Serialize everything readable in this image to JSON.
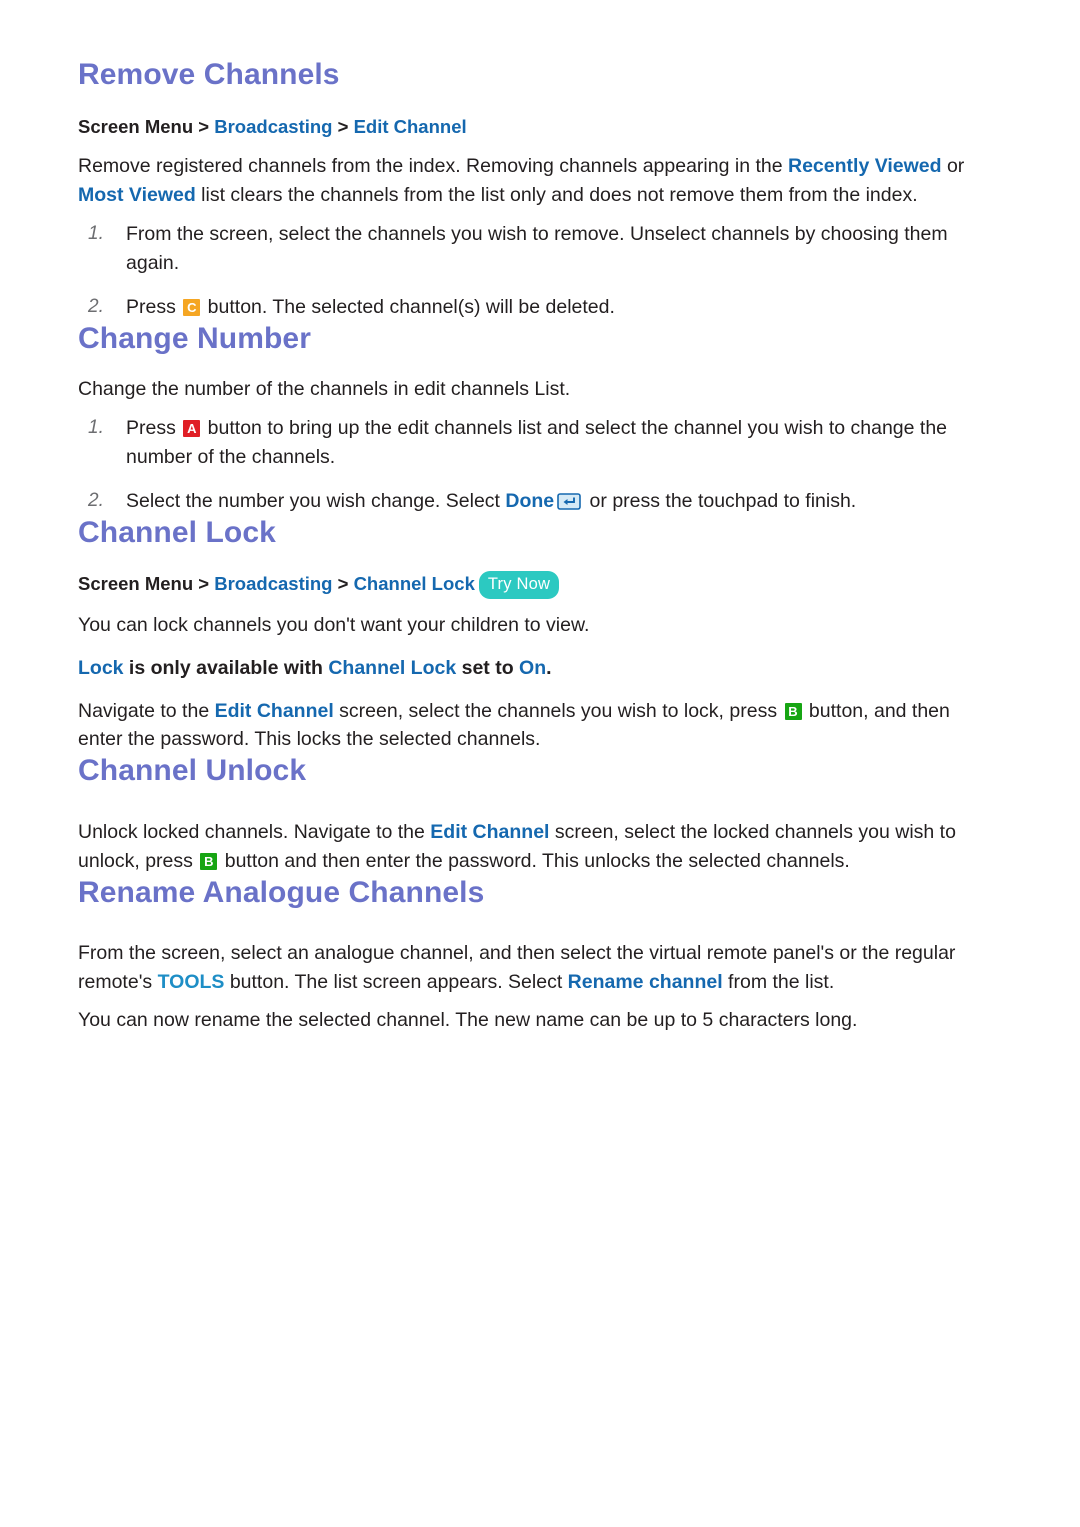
{
  "colors": {
    "heading": "#6a72c8",
    "link": "#1568af",
    "link_light": "#1e8ec6",
    "key_a": "#e01f26",
    "key_b": "#17a513",
    "key_c": "#f5a623",
    "try_now": "#2cc9c1",
    "body": "#231f20",
    "step_number": "#6d6e71"
  },
  "sections": {
    "remove_channels": {
      "title": "Remove Channels",
      "breadcrumb": {
        "root": "Screen Menu",
        "sep": ">",
        "level1": "Broadcasting",
        "level2": "Edit Channel"
      },
      "intro": {
        "part1": "Remove registered channels from the index. Removing channels appearing in the ",
        "link1": "Recently Viewed",
        "part2": " or ",
        "link2": "Most Viewed",
        "part3": " list clears the channels from the list only and does not remove them from the index."
      },
      "steps": [
        {
          "number": "1.",
          "text": "From the screen, select the channels you wish to remove. Unselect channels by choosing them again."
        },
        {
          "number": "2.",
          "prefix": "Press ",
          "key": "C",
          "suffix": " button. The selected channel(s) will be deleted."
        }
      ]
    },
    "change_number": {
      "title": "Change Number",
      "intro": "Change the number of the channels in edit channels List.",
      "steps": [
        {
          "number": "1.",
          "prefix": "Press ",
          "key": "A",
          "suffix": " button to bring up the edit channels list and select the channel you wish to change the number of the channels."
        },
        {
          "number": "2.",
          "prefix": "Select the number you wish change. Select ",
          "link": "Done",
          "icon": "enter-key-icon",
          "suffix": " or press the touchpad to finish."
        }
      ]
    },
    "channel_lock": {
      "title": "Channel Lock",
      "breadcrumb": {
        "root": "Screen Menu",
        "sep": ">",
        "level1": "Broadcasting",
        "level2": "Channel Lock",
        "badge": "Try Now"
      },
      "para1": "You can lock channels you don't want your children to view.",
      "para2": {
        "link1": "Lock",
        "mid1": " is only available with ",
        "link2": "Channel Lock",
        "mid2": " set to ",
        "link3": "On",
        "end": "."
      },
      "para3": {
        "part1": "Navigate to the ",
        "link1": "Edit Channel",
        "part2": " screen, select the channels you wish to lock, press ",
        "key": "B",
        "part3": " button, and then enter the password. This locks the selected channels."
      }
    },
    "channel_unlock": {
      "title": "Channel Unlock",
      "para1": {
        "part1": "Unlock locked channels. Navigate to the ",
        "link1": "Edit Channel",
        "part2": " screen, select the locked channels you wish to unlock, press ",
        "key": "B",
        "part3": " button and then enter the password. This unlocks the selected channels."
      }
    },
    "rename_analogue_channels": {
      "title": "Rename Analogue Channels",
      "para1": {
        "part1": "From the screen, select an analogue channel, and then select the virtual remote panel's or the regular remote's ",
        "link1": "TOOLS",
        "part2": " button. The list screen appears. Select ",
        "link2": "Rename channel",
        "part3": " from the list."
      },
      "para2": "You can now rename the selected channel. The new name can be up to 5 characters long."
    }
  }
}
